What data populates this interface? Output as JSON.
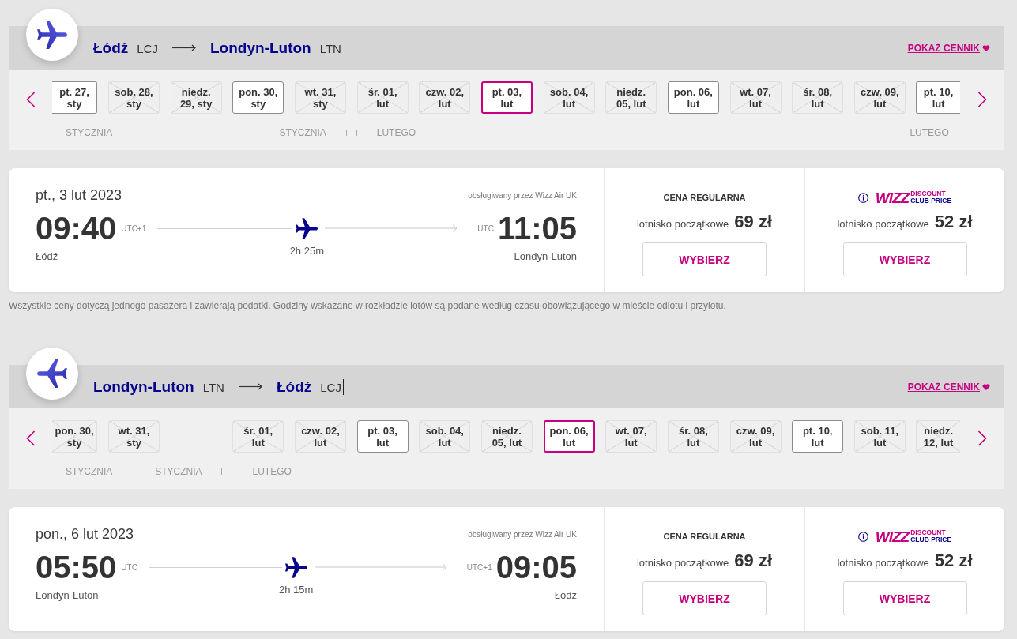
{
  "sections": [
    {
      "kind": "outbound",
      "route": {
        "from": {
          "city": "Łódź",
          "code": "LCJ"
        },
        "to": {
          "city": "Londyn-Luton",
          "code": "LTN"
        },
        "text_cursor": false
      },
      "price_list_link": "POKAŻ CENNIK",
      "date_strip": {
        "months": [
          {
            "labels": [
              "STYCZNIA",
              "STYCZNIA"
            ],
            "days": [
              {
                "kind": "day",
                "lines": [
                  "pt. 27,",
                  "sty"
                ],
                "disabled": false,
                "selected": false
              },
              {
                "kind": "day",
                "lines": [
                  "sob. 28,",
                  "sty"
                ],
                "disabled": true,
                "selected": false
              },
              {
                "kind": "day",
                "lines": [
                  "niedz.",
                  "29, sty"
                ],
                "disabled": true,
                "selected": false
              },
              {
                "kind": "day",
                "lines": [
                  "pon. 30,",
                  "sty"
                ],
                "disabled": false,
                "selected": false
              },
              {
                "kind": "day",
                "lines": [
                  "wt. 31,",
                  "sty"
                ],
                "disabled": true,
                "selected": false
              }
            ]
          },
          {
            "labels": [
              "LUTEGO",
              "LUTEGO"
            ],
            "days": [
              {
                "kind": "day",
                "lines": [
                  "śr. 01,",
                  "lut"
                ],
                "disabled": true,
                "selected": false
              },
              {
                "kind": "day",
                "lines": [
                  "czw. 02,",
                  "lut"
                ],
                "disabled": true,
                "selected": false
              },
              {
                "kind": "day",
                "lines": [
                  "pt. 03,",
                  "lut"
                ],
                "disabled": false,
                "selected": true
              },
              {
                "kind": "day",
                "lines": [
                  "sob. 04,",
                  "lut"
                ],
                "disabled": true,
                "selected": false
              },
              {
                "kind": "day",
                "lines": [
                  "niedz.",
                  "05, lut"
                ],
                "disabled": true,
                "selected": false
              },
              {
                "kind": "day",
                "lines": [
                  "pon. 06,",
                  "lut"
                ],
                "disabled": false,
                "selected": false
              },
              {
                "kind": "day",
                "lines": [
                  "wt. 07,",
                  "lut"
                ],
                "disabled": true,
                "selected": false
              },
              {
                "kind": "day",
                "lines": [
                  "śr. 08,",
                  "lut"
                ],
                "disabled": true,
                "selected": false
              },
              {
                "kind": "day",
                "lines": [
                  "czw. 09,",
                  "lut"
                ],
                "disabled": true,
                "selected": false
              },
              {
                "kind": "day",
                "lines": [
                  "pt. 10,",
                  "lut"
                ],
                "disabled": false,
                "selected": false
              }
            ]
          }
        ]
      },
      "flight": {
        "date": "pt., 3 lut 2023",
        "operator": "obsługiwany przez Wizz Air UK",
        "departure": {
          "time": "09:40",
          "zone": "UTC+1",
          "city": "Łódź"
        },
        "duration": "2h 25m",
        "arrival": {
          "time": "11:05",
          "zone": "UTC",
          "city": "Londyn-Luton"
        },
        "fares": [
          {
            "kind": "regular",
            "title": "CENA REGULARNA",
            "label": "lotnisko początkowe",
            "price": "69 zł",
            "button": "WYBIERZ"
          },
          {
            "kind": "club",
            "logo": {
              "wordmark": "WIZZ",
              "line_1": "DISCOUNT",
              "line_2": "CLUB PRICE"
            },
            "label": "lotnisko początkowe",
            "price": "52 zł",
            "button": "WYBIERZ"
          }
        ]
      },
      "disclaimer": "Wszystkie ceny dotyczą jednego pasażera i zawierają podatki. Godziny wskazane w rozkładzie lotów są podane według czasu obowiązującego w mieście odlotu i przylotu."
    },
    {
      "kind": "return",
      "route": {
        "from": {
          "city": "Londyn-Luton",
          "code": "LTN"
        },
        "to": {
          "city": "Łódź",
          "code": "LCJ"
        },
        "text_cursor": true
      },
      "price_list_link": "POKAŻ CENNIK",
      "date_strip": {
        "months": [
          {
            "labels": [
              "STYCZNIA",
              "STYCZNIA"
            ],
            "days": [
              {
                "kind": "day",
                "lines": [
                  "pon. 30,",
                  "sty"
                ],
                "disabled": true,
                "selected": false
              },
              {
                "kind": "day",
                "lines": [
                  "wt. 31,",
                  "sty"
                ],
                "disabled": true,
                "selected": false
              },
              {
                "kind": "empty"
              }
            ]
          },
          {
            "labels": [
              "LUTEGO"
            ],
            "days": [
              {
                "kind": "day",
                "lines": [
                  "śr. 01,",
                  "lut"
                ],
                "disabled": true,
                "selected": false
              },
              {
                "kind": "day",
                "lines": [
                  "czw. 02,",
                  "lut"
                ],
                "disabled": true,
                "selected": false
              },
              {
                "kind": "day",
                "lines": [
                  "pt. 03,",
                  "lut"
                ],
                "disabled": false,
                "selected": false
              },
              {
                "kind": "day",
                "lines": [
                  "sob. 04,",
                  "lut"
                ],
                "disabled": true,
                "selected": false
              },
              {
                "kind": "day",
                "lines": [
                  "niedz.",
                  "05, lut"
                ],
                "disabled": true,
                "selected": false
              },
              {
                "kind": "day",
                "lines": [
                  "pon. 06,",
                  "lut"
                ],
                "disabled": false,
                "selected": true
              },
              {
                "kind": "day",
                "lines": [
                  "wt. 07,",
                  "lut"
                ],
                "disabled": true,
                "selected": false
              },
              {
                "kind": "day",
                "lines": [
                  "śr. 08,",
                  "lut"
                ],
                "disabled": true,
                "selected": false
              },
              {
                "kind": "day",
                "lines": [
                  "czw. 09,",
                  "lut"
                ],
                "disabled": true,
                "selected": false
              },
              {
                "kind": "day",
                "lines": [
                  "pt. 10,",
                  "lut"
                ],
                "disabled": false,
                "selected": false
              },
              {
                "kind": "day",
                "lines": [
                  "sob. 11,",
                  "lut"
                ],
                "disabled": true,
                "selected": false
              },
              {
                "kind": "day",
                "lines": [
                  "niedz.",
                  "12, lut"
                ],
                "disabled": true,
                "selected": false
              }
            ]
          }
        ]
      },
      "flight": {
        "date": "pon., 6 lut 2023",
        "operator": "obsługiwany przez Wizz Air UK",
        "departure": {
          "time": "05:50",
          "zone": "UTC",
          "city": "Londyn-Luton"
        },
        "duration": "2h 15m",
        "arrival": {
          "time": "09:05",
          "zone": "UTC+1",
          "city": "Łódź"
        },
        "fares": [
          {
            "kind": "regular",
            "title": "CENA REGULARNA",
            "label": "lotnisko początkowe",
            "price": "69 zł",
            "button": "WYBIERZ"
          },
          {
            "kind": "club",
            "logo": {
              "wordmark": "WIZZ",
              "line_1": "DISCOUNT",
              "line_2": "CLUB PRICE"
            },
            "label": "lotnisko początkowe",
            "price": "52 zł",
            "button": "WYBIERZ"
          }
        ]
      }
    }
  ]
}
